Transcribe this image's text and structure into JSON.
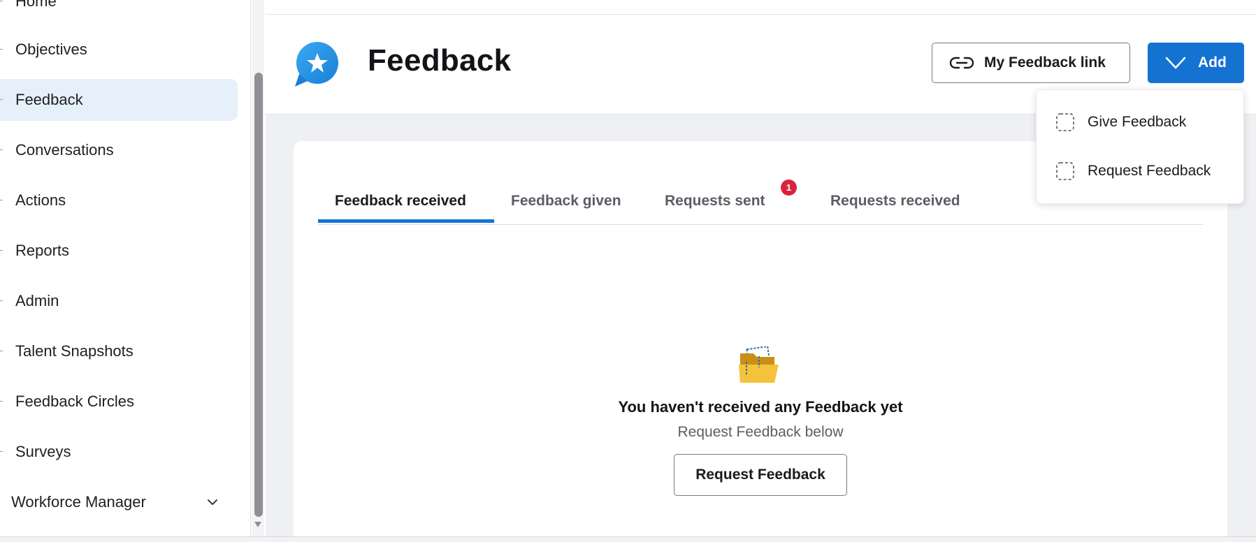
{
  "sidebar": {
    "items": [
      {
        "label": "Home"
      },
      {
        "label": "Objectives"
      },
      {
        "label": "Feedback"
      },
      {
        "label": "Conversations"
      },
      {
        "label": "Actions"
      },
      {
        "label": "Reports"
      },
      {
        "label": "Admin"
      },
      {
        "label": "Talent Snapshots"
      },
      {
        "label": "Feedback Circles"
      },
      {
        "label": "Surveys"
      },
      {
        "label": "Workforce Manager"
      }
    ],
    "active_item": "Feedback"
  },
  "header": {
    "title": "Feedback",
    "my_feedback_link_label": "My Feedback link",
    "add_label": "Add"
  },
  "add_menu": {
    "items": [
      {
        "label": "Give Feedback"
      },
      {
        "label": "Request Feedback"
      }
    ]
  },
  "tabs": {
    "items": [
      {
        "label": "Feedback received"
      },
      {
        "label": "Feedback given"
      },
      {
        "label": "Requests sent"
      },
      {
        "label": "Requests received"
      }
    ],
    "active": "Feedback received",
    "requests_sent_badge": "1"
  },
  "empty_state": {
    "title": "You haven't received any Feedback yet",
    "subtitle": "Request Feedback below",
    "button_label": "Request Feedback"
  },
  "colors": {
    "accent": "#1473d1",
    "active_nav_bg": "#e6f0fb",
    "badge": "#d8243b",
    "page_bg": "#eef0f3"
  }
}
